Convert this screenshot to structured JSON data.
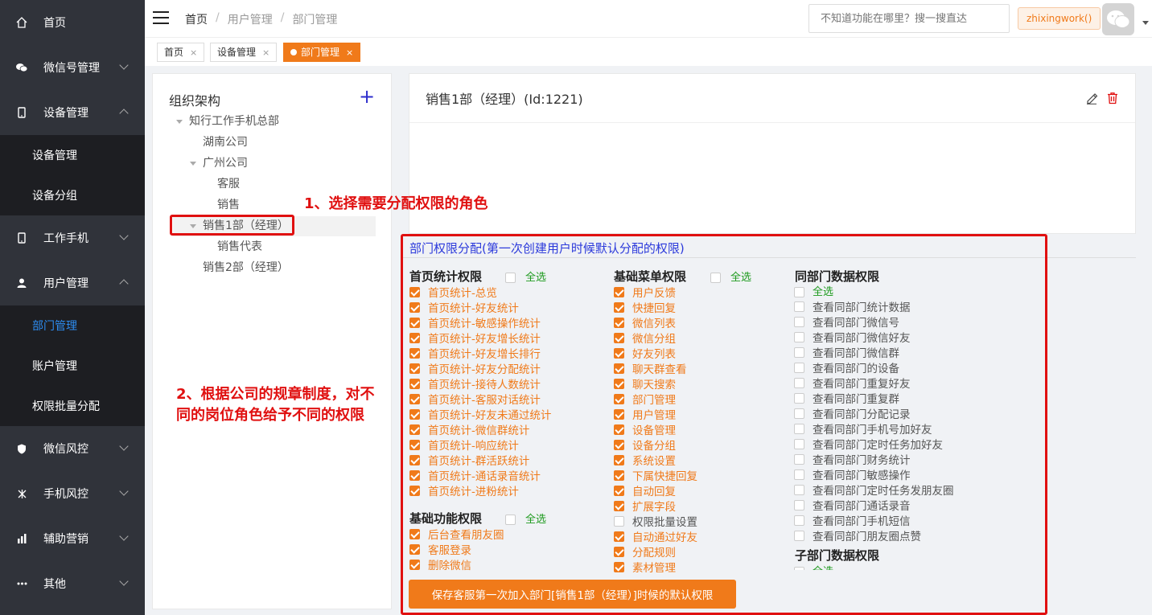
{
  "sidebar": {
    "items": [
      {
        "label": "首页",
        "icon": "home-icon"
      },
      {
        "label": "微信号管理",
        "icon": "wechat-icon"
      },
      {
        "label": "设备管理",
        "icon": "device-icon"
      },
      {
        "label": "设备管理"
      },
      {
        "label": "设备分组"
      },
      {
        "label": "工作手机",
        "icon": "phone-icon"
      },
      {
        "label": "用户管理",
        "icon": "user-icon"
      },
      {
        "label": "部门管理"
      },
      {
        "label": "账户管理"
      },
      {
        "label": "权限批量分配"
      },
      {
        "label": "微信风控",
        "icon": "shield-icon"
      },
      {
        "label": "手机风控",
        "icon": "risk-icon"
      },
      {
        "label": "辅助营销",
        "icon": "chart-icon"
      },
      {
        "label": "其他",
        "icon": "more-icon"
      }
    ]
  },
  "header": {
    "breadcrumb": [
      "首页",
      "/",
      "用户管理",
      "/",
      "部门管理"
    ],
    "search_placeholder": "不知道功能在哪里？搜一搜直达",
    "user": "zhixingwork()"
  },
  "tabs": [
    {
      "label": "首页",
      "close": "×"
    },
    {
      "label": "设备管理",
      "close": "×"
    },
    {
      "label": "部门管理",
      "close": "×"
    }
  ],
  "tree": {
    "title": "组织架构",
    "nodes": [
      "知行工作手机总部",
      "湖南公司",
      "广州公司",
      "客服",
      "销售",
      "销售1部（经理）",
      "销售代表",
      "销售2部（经理）"
    ]
  },
  "detail": {
    "title": "销售1部（经理）(Id:1221)"
  },
  "perm": {
    "title": "部门权限分配(第一次创建用户时候默认分配的权限)",
    "select_all": "全选",
    "col1": {
      "title": "首页统计权限",
      "items": [
        "首页统计-总览",
        "首页统计-好友统计",
        "首页统计-敏感操作统计",
        "首页统计-好友增长统计",
        "首页统计-好友增长排行",
        "首页统计-好友分配统计",
        "首页统计-接待人数统计",
        "首页统计-客服对话统计",
        "首页统计-好友未通过统计",
        "首页统计-微信群统计",
        "首页统计-响应统计",
        "首页统计-群活跃统计",
        "首页统计-通话录音统计",
        "首页统计-进粉统计"
      ],
      "title2": "基础功能权限",
      "items2": [
        "后台查看朋友圈",
        "客服登录",
        "删除微信"
      ]
    },
    "col2": {
      "title": "基础菜单权限",
      "items": [
        "用户反馈",
        "快捷回复",
        "微信列表",
        "微信分组",
        "好友列表",
        "聊天群查看",
        "聊天搜索",
        "部门管理",
        "用户管理",
        "设备管理",
        "设备分组",
        "系统设置",
        "下属快捷回复",
        "自动回复",
        "扩展字段",
        "权限批量设置",
        "自动通过好友",
        "分配规则",
        "素材管理"
      ]
    },
    "col3": {
      "title": "同部门数据权限",
      "items": [
        "查看同部门统计数据",
        "查看同部门微信号",
        "查看同部门微信好友",
        "查看同部门微信群",
        "查看同部门的设备",
        "查看同部门重复好友",
        "查看同部门重复群",
        "查看同部门分配记录",
        "查看同部门手机号加好友",
        "查看同部门定时任务加好友",
        "查看同部门财务统计",
        "查看同部门敏感操作",
        "查看同部门定时任务发朋友圈",
        "查看同部门通话录音",
        "查看同部门手机短信",
        "查看同部门朋友圈点赞"
      ],
      "title2": "子部门数据权限"
    },
    "save_label": "保存客服第一次加入部门[销售1部（经理）]时候的默认权限"
  },
  "annotations": {
    "a1": "1、选择需要分配权限的角色",
    "a2_line1": "2、根据公司的规章制度，对不",
    "a2_line2": "同的岗位角色给予不同的权限"
  },
  "colors": {
    "accent": "#f07a1a",
    "sidebar": "#30333a",
    "annotation": "#e01010",
    "link": "#2d8cf0"
  }
}
